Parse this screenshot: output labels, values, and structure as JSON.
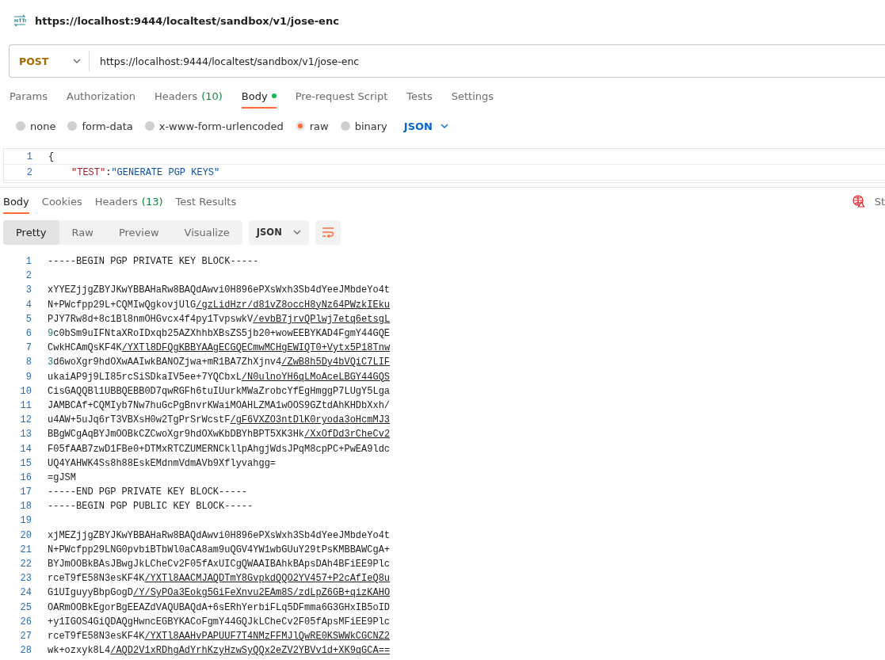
{
  "request": {
    "title": "https://localhost:9444/localtest/sandbox/v1/jose-enc",
    "method": "POST",
    "url": "https://localhost:9444/localtest/sandbox/v1/jose-enc"
  },
  "request_tabs": [
    {
      "label": "Params",
      "selected": false
    },
    {
      "label": "Authorization",
      "selected": false
    },
    {
      "label": "Headers",
      "count": "(10)",
      "selected": false
    },
    {
      "label": "Body",
      "selected": true,
      "dot": true
    },
    {
      "label": "Pre-request Script",
      "selected": false
    },
    {
      "label": "Tests",
      "selected": false
    },
    {
      "label": "Settings",
      "selected": false
    }
  ],
  "body_types": [
    {
      "label": "none",
      "selected": false
    },
    {
      "label": "form-data",
      "selected": false
    },
    {
      "label": "x-www-form-urlencoded",
      "selected": false
    },
    {
      "label": "raw",
      "selected": true
    },
    {
      "label": "binary",
      "selected": false
    }
  ],
  "body_format": "JSON",
  "editor_lines": [
    {
      "number": "1",
      "text": "{"
    },
    {
      "number": "2",
      "key": "\"TEST\"",
      "sep": ":",
      "value": "\"GENERATE PGP KEYS\""
    }
  ],
  "response_tabs": [
    {
      "label": "Body",
      "selected": true
    },
    {
      "label": "Cookies",
      "selected": false
    },
    {
      "label": "Headers",
      "count": "(13)",
      "selected": false
    },
    {
      "label": "Test Results",
      "selected": false
    }
  ],
  "status_text": "St",
  "view_modes": [
    {
      "label": "Pretty",
      "selected": true
    },
    {
      "label": "Raw",
      "selected": false
    },
    {
      "label": "Preview",
      "selected": false
    },
    {
      "label": "Visualize",
      "selected": false
    }
  ],
  "response_format": "JSON",
  "response_lines": [
    {
      "number": "1",
      "text": "-----BEGIN PGP PRIVATE KEY BLOCK-----"
    },
    {
      "number": "2"
    },
    {
      "number": "3",
      "text": "xYYEZjjgZBYJKwYBBAHaRw8BAQdAwvi0H896ePXsWxh3Sb4dYeeJMbdeYo4t"
    },
    {
      "number": "4",
      "text": "N+PWcfpp29L+CQMIwQgkovjUlG",
      "link": "/gzLidHzr/d81vZ8occH8yNz64PWzkIEku"
    },
    {
      "number": "5",
      "text": "PJY7Rw8d+8c1Bl8nmOHGvcx4f4py1TvpswkV",
      "link": "/evbB7jrvQPlwj7etq6etsgL"
    },
    {
      "number": "6",
      "lead": "9",
      "text": "c0bSm9uIFNtaXRoIDxqb25AZXhhbXBsZS5jb20+wowEEBYKAD4FgmY44GQE"
    },
    {
      "number": "7",
      "text": "CwkHCAmQsKF4K",
      "link": "/YXTl8DFQgKBBYAAgECGQECmwMCHgEWIQT0+Vytx5P18Tnw"
    },
    {
      "number": "8",
      "lead": "3",
      "text": "d6woXgr9hdOXwAAIwkBANOZjwa+mR1BA7ZhXjnv4",
      "link": "/ZwB8h5Dy4bVQiC7LIF"
    },
    {
      "number": "9",
      "text": "ukaiAP9j9LI85rcSiSDkaIV5ee+7YQCbxL",
      "link": "/N0ulnoYH6qLMoAceLBGY44GQS"
    },
    {
      "number": "10",
      "text": "CisGAQQBl1UBBQEBB0D7qwRGFh6tuIUurkMWaZrobcYfEgHmggP7LUgY5Lga"
    },
    {
      "number": "11",
      "text": "JAMBCAf+CQMIyb7Nw7huGcPgBnvrKWaiMOAHLZMA1wOOS9GZtdAhKHDbXxh/"
    },
    {
      "number": "12",
      "text": "u4AW+5uJq6rT3VBXsH0w2TgPrSrWcstF",
      "link": "/gF6VXZO3ntDlK0ryoda3oHcmMJ3"
    },
    {
      "number": "13",
      "text": "BBgWCgAqBYJmOOBkCZCwoXgr9hdOXwKbDBYhBPT5XK3Hk",
      "link": "/XxOfDd3rCheCv2"
    },
    {
      "number": "14",
      "text": "F05fAAB7zwD1FBe0+DTMxRTCZUMERNCkllpAhgjWdsJPqM8cpPC+PwEA9ldc"
    },
    {
      "number": "15",
      "text": "UQ4YAHWK4Ss8h88EskEMdnmVdmAVb9Xflyvahgg="
    },
    {
      "number": "16",
      "text": "=gJSM"
    },
    {
      "number": "17",
      "text": "-----END PGP PRIVATE KEY BLOCK-----"
    },
    {
      "number": "18",
      "text": "-----BEGIN PGP PUBLIC KEY BLOCK-----"
    },
    {
      "number": "19"
    },
    {
      "number": "20",
      "text": "xjMEZjjgZBYJKwYBBAHaRw8BAQdAwvi0H896ePXsWxh3Sb4dYeeJMbdeYo4t"
    },
    {
      "number": "21",
      "text": "N+PWcfpp29LNG0pvbiBTbWl0aCA8am9uQGV4YW1wbGUuY29tPsKMBBAWCgA+"
    },
    {
      "number": "22",
      "text": "BYJmOOBkBAsJBwgJkLCheCv2F05fAxUICgQWAAIBAhkBApsDAh4BFiEE9Plc"
    },
    {
      "number": "23",
      "text": "rceT9fE58N3esKF4K",
      "link": "/YXTl8AACMJAQDTmY8GvpkdQQO2YV457+P2cAfIeQ8u"
    },
    {
      "number": "24",
      "text": "G1UIguyyBbpGogD",
      "link": "/Y/SyPOa3Eokg5GiFeXnvu2EAm8S/zdLpZ6GB+qizKAHO"
    },
    {
      "number": "25",
      "text": "OARmOOBkEgorBgEEAZdVAQUBAQdA+6sERhYerbiFLq5DFmma6G3GHxIB5oID"
    },
    {
      "number": "26",
      "text": "+y1IGOS4GiQDAQgHwncEGBYKACoFgmY44GQJkLCheCv2F05fApsMFiEE9Plc"
    },
    {
      "number": "27",
      "text": "rceT9fE58N3esKF4K",
      "link": "/YXTl8AAHvPAPUUF7T4NMzFFMJlQwRE0KSWWkCGCNZ2"
    },
    {
      "number": "28",
      "text": "wk+ozxyk8L4",
      "link": "/AQD2V1xRDhgAdYrhKzyHzwSyQQx2eZV2YBVv1d+XK9qGCA=="
    }
  ]
}
